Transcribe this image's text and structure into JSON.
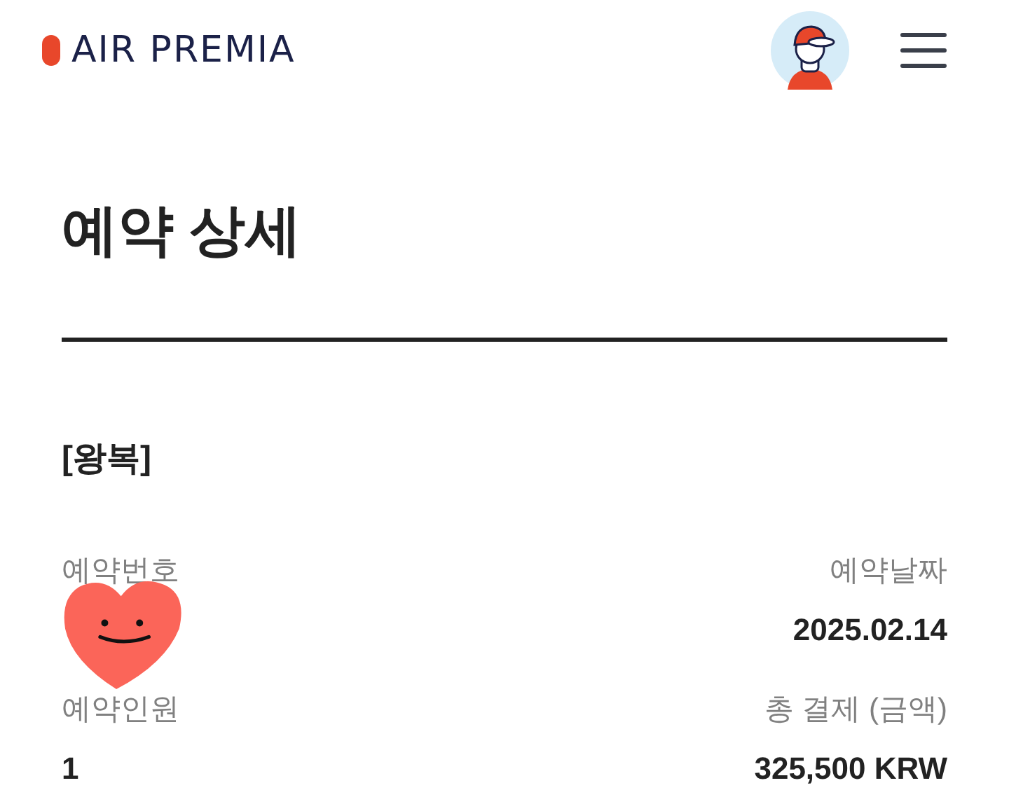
{
  "header": {
    "logo": "AIR PREMIA"
  },
  "page_title": "예약 상세",
  "trip_type": "[왕복]",
  "details": [
    {
      "label": "예약번호"
    },
    {
      "label": "예약날짜",
      "value": "2025.02.14"
    },
    {
      "label": "예약인원",
      "value": "1"
    },
    {
      "label": "총 결제 (금액)",
      "value": "325,500 KRW"
    }
  ]
}
